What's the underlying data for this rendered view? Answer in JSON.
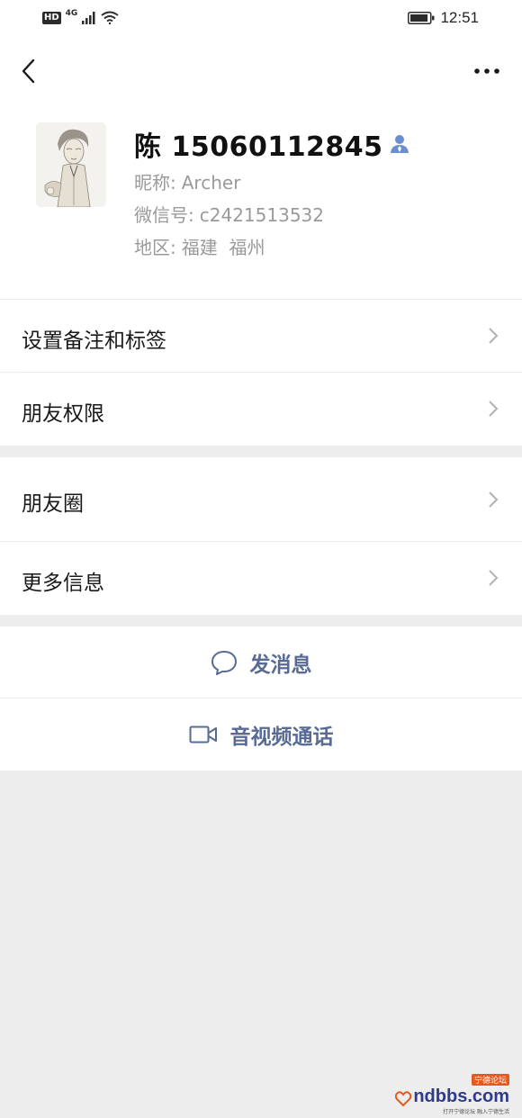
{
  "status_bar": {
    "hd": "HD",
    "network": "4G",
    "time": "12:51"
  },
  "profile": {
    "name": "陈 15060112845",
    "nickname_label": "昵称:",
    "nickname": "Archer",
    "wechat_id_label": "微信号:",
    "wechat_id": "c2421513532",
    "region_label": "地区:",
    "region": "福建  福州"
  },
  "menu": {
    "remark_tags": "设置备注和标签",
    "friend_permissions": "朋友权限",
    "moments": "朋友圈",
    "more_info": "更多信息"
  },
  "actions": {
    "send_message": "发消息",
    "av_call": "音视频通话"
  },
  "watermark": {
    "text": "ndbbs.com",
    "tag": "宁德论坛",
    "sub": "打开宁德论坛 融入宁德生活"
  },
  "colors": {
    "link": "#576b95",
    "background": "#ededed",
    "card": "#ffffff"
  }
}
